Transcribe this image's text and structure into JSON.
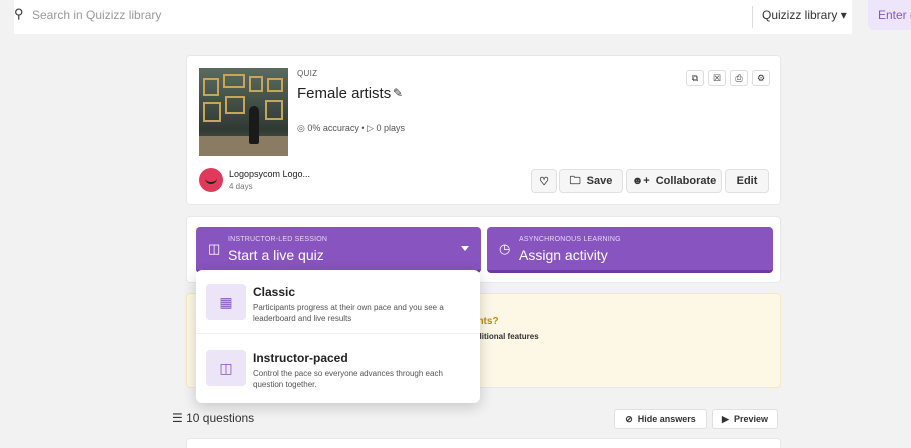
{
  "search": {
    "placeholder": "Search in Quizizz library",
    "library_select": "Quizizz library",
    "enter_label": "Enter c"
  },
  "quiz": {
    "type": "QUIZ",
    "title": "Female artists",
    "accuracy": "0% accuracy",
    "plays": "0 plays",
    "author": "Logopsycom Logo...",
    "time": "4 days",
    "icons": [
      "copy-icon",
      "trash-icon",
      "print-icon",
      "settings-icon",
      "pencil-icon",
      "heart-icon",
      "folder-icon",
      "add-user-icon"
    ]
  },
  "actions": {
    "save": "Save",
    "collaborate": "Collaborate",
    "edit": "Edit"
  },
  "session": {
    "live_small": "INSTRUCTOR-LED SESSION",
    "live_big": "Start a live quiz",
    "assign_small": "ASYNCHRONOUS LEARNING",
    "assign_big": "Assign activity"
  },
  "dropdown": {
    "options": [
      {
        "title": "Classic",
        "desc": "Participants progress at their own pace and you see a leaderboard and live results"
      },
      {
        "title": "Instructor-paced",
        "desc": "Control the pace so everyone advances through each question together."
      }
    ]
  },
  "info": {
    "question_fragment": "ipants?",
    "features_fragment": "dditional features"
  },
  "questions": {
    "count": "10 questions",
    "hide_answers": "Hide answers",
    "preview": "Preview"
  },
  "colors": {
    "accent": "#8854c0",
    "info_bg": "#fdf7e6",
    "info_text": "#c58a0f"
  }
}
